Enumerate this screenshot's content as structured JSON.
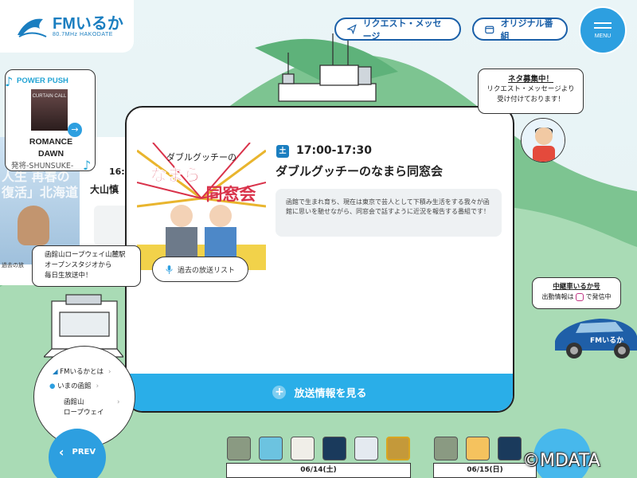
{
  "header": {
    "logo_name": "FMいるか",
    "logo_freq": "80.7MHz HAKODATE",
    "request_label": "リクエスト・メッセージ",
    "original_label": "オリジナル番組",
    "menu_label": "MENU"
  },
  "power_push": {
    "heading": "POWER PUSH",
    "cover_text": "CURTAIN CALL",
    "song_line1": "ROMANCE",
    "song_line2": "DAWN",
    "artist": "発将-SHUNSUKE-"
  },
  "back_program": {
    "time": "16:",
    "title": "大山慎",
    "photo_text_1": "人生 再春の",
    "photo_text_2": "復活」北海道",
    "past_label": "過去の放"
  },
  "current_program": {
    "day": "土",
    "time": "17:00-17:30",
    "title": "ダブルグッチーのなまら同窓会",
    "description": "函館で生まれ育ち、現在は東京で芸人として下積み生活をする我々が函館に思いを馳せながら、同窓会で話すように近況を報告する番組です！",
    "art_line1": "ダブルグッチーの",
    "art_line2": "なまら",
    "art_line3": "同窓会",
    "past_list_label": "過去の放送リスト",
    "more_label": "放送情報を見る"
  },
  "neta": {
    "title": "ネタ募集中！",
    "line1": "リクエスト・メッセージより",
    "line2": "受け付けております！"
  },
  "studio_bubble": {
    "line1": "函館山ロープウェイ山麓駅",
    "line2": "オープンスタジオから",
    "line3": "毎日生放送中！"
  },
  "relay_bubble": {
    "title": "中継車いるか号",
    "line_pre": "出動情報は",
    "line_post": "で発信中"
  },
  "nav": {
    "about": "FMいるかとは",
    "now": "いまの函館",
    "ropeway_1": "函館山",
    "ropeway_2": "ロープウェイ"
  },
  "buttons": {
    "prev": "PREV"
  },
  "timeline": {
    "date1": "06/14(土)",
    "date2": "06/15(日)"
  },
  "car_text": "FMいるか",
  "copyright": "©MDATA",
  "colors": {
    "primary": "#2d9fe0",
    "navy": "#1a5fa8",
    "accent_bar": "#2aaee8"
  }
}
